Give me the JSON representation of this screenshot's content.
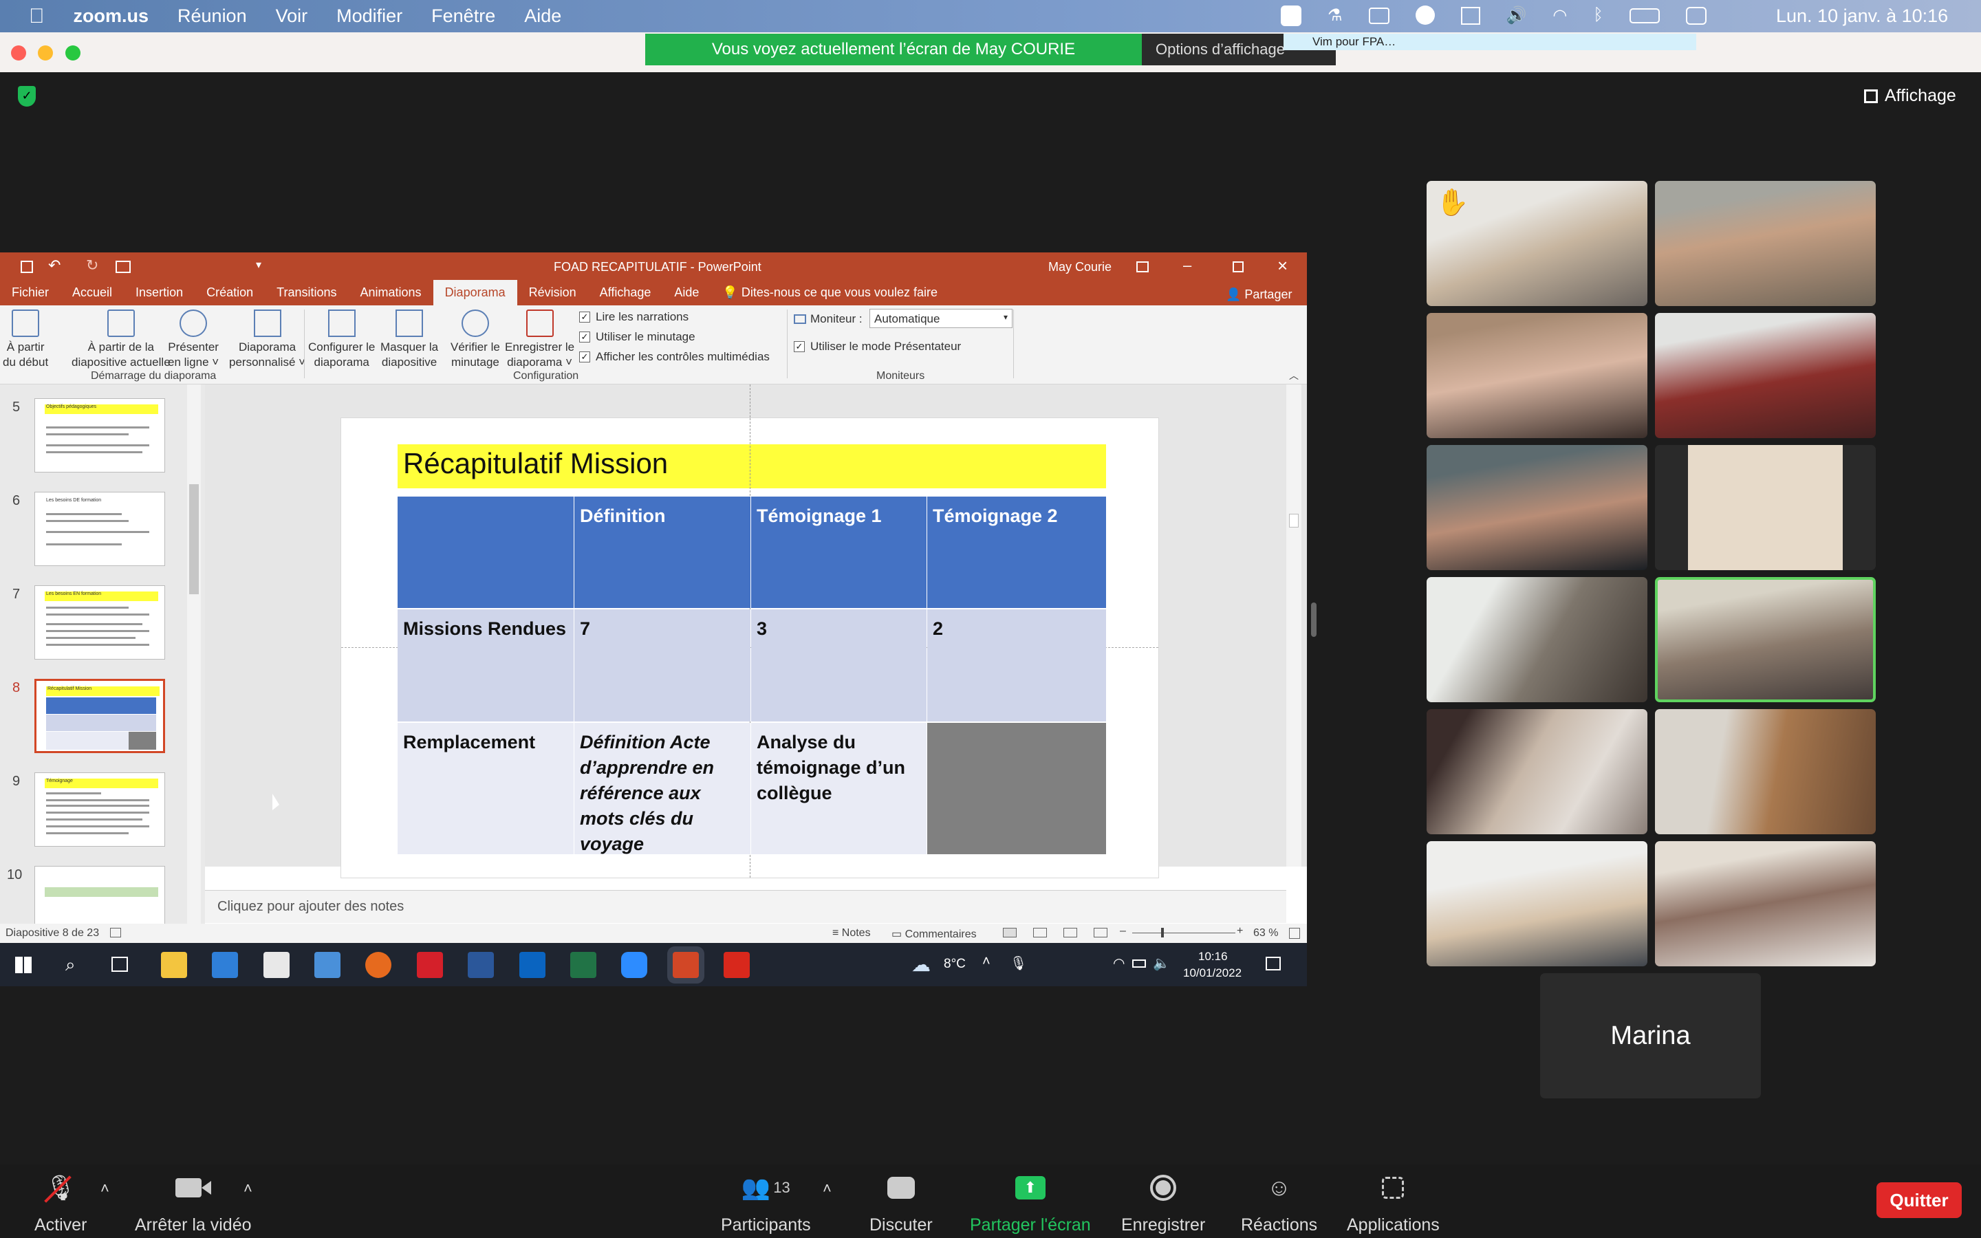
{
  "menubar": {
    "app": "zoom.us",
    "items": [
      "Réunion",
      "Voir",
      "Modifier",
      "Fenêtre",
      "Aide"
    ],
    "clock": "Lun. 10 janv. à 10:16"
  },
  "share_banner": {
    "text": "Vous voyez actuellement l’écran de May COURIE",
    "options": "Options d’affichage",
    "tooltip": "Vim pour FPA…"
  },
  "view_button": "Affichage",
  "ppt": {
    "title": "FOAD RECAPITULATIF  -  PowerPoint",
    "user": "May Courie",
    "tabs": [
      "Fichier",
      "Accueil",
      "Insertion",
      "Création",
      "Transitions",
      "Animations",
      "Diaporama",
      "Révision",
      "Affichage",
      "Aide"
    ],
    "active_tab": "Diaporama",
    "tell_me": "Dites-nous ce que vous voulez faire",
    "share": "Partager",
    "ribbon": {
      "b1": [
        "À partir",
        "du début"
      ],
      "b2": [
        "À partir de la",
        "diapositive actuelle"
      ],
      "b3": [
        "Présenter",
        "en ligne ˅"
      ],
      "b4": [
        "Diaporama",
        "personnalisé ˅"
      ],
      "b5": [
        "Configurer le",
        "diaporama"
      ],
      "b6": [
        "Masquer la",
        "diapositive"
      ],
      "b7": [
        "Vérifier le",
        "minutage"
      ],
      "b8": [
        "Enregistrer le",
        "diaporama ˅"
      ],
      "chk1": "Lire les narrations",
      "chk2": "Utiliser le minutage",
      "chk3": "Afficher les contrôles multimédias",
      "monitor_label": "Moniteur :",
      "monitor_value": "Automatique",
      "presenter": "Utiliser le mode Présentateur",
      "g1": "Démarrage du diaporama",
      "g2": "Configuration",
      "g3": "Moniteurs"
    },
    "thumbs": [
      {
        "num": "5",
        "title": "Objectifs pédagogiques"
      },
      {
        "num": "6",
        "title": "Les besoins DE formation"
      },
      {
        "num": "7",
        "title": "Les besoins EN formation"
      },
      {
        "num": "8",
        "title": "Récapitulatif Mission"
      },
      {
        "num": "9",
        "title": "Témoignage"
      },
      {
        "num": "10",
        "title": ""
      }
    ],
    "slide": {
      "title": "Récapitulatif Mission",
      "headers": [
        "",
        "Définition",
        "Témoignage 1",
        "Témoignage 2"
      ],
      "rows": [
        {
          "label": "Missions Rendues",
          "def": "7",
          "t1": "3",
          "t2": "2"
        },
        {
          "label": "Remplacement",
          "def": "Définition Acte d’apprendre en référence aux mots clés du voyage",
          "t1": "Analyse du témoignage d’un collègue",
          "t2": ""
        }
      ]
    },
    "notes": "Cliquez pour ajouter des notes",
    "status": {
      "slide": "Diapositive 8 de 23",
      "notes": "Notes",
      "comments": "Commentaires",
      "zoom": "63 %"
    },
    "taskbar": {
      "temp": "8°C",
      "time": "10:16",
      "date": "10/01/2022"
    }
  },
  "participant_name": "Marina",
  "controls": {
    "mute": "Activer",
    "video": "Arrêter la vidéo",
    "participants": "Participants",
    "participants_count": "13",
    "chat": "Discuter",
    "share": "Partager l'écran",
    "record": "Enregistrer",
    "reactions": "Réactions",
    "apps": "Applications",
    "quit": "Quitter"
  },
  "colors": {
    "share_green": "#22b14c",
    "ppt_red": "#b7472a",
    "table_blue": "#4472c4",
    "table_row1": "#cfd5ea",
    "table_row2": "#e9ebf5",
    "quit_red": "#e02828",
    "slide_yellow": "#ffff3a"
  }
}
